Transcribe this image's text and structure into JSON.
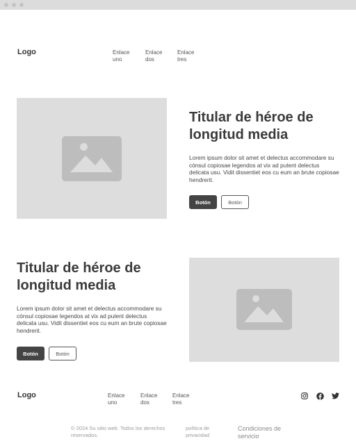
{
  "header": {
    "logo": "Logo",
    "nav": [
      {
        "label": "Enlace uno"
      },
      {
        "label": "Enlace dos"
      },
      {
        "label": "Enlace tres"
      }
    ]
  },
  "hero1": {
    "title": "Titular de héroe de longitud media",
    "body": "Lorem ipsum dolor sit amet et delectus accommodare su cónsul copiosae legendos at vix ad putent delectus delicata usu. Vidit dissentiet eos cu eum an brute copiosae hendrerit.",
    "primary_button": "Botón",
    "secondary_button": "Botón",
    "image_icon": "image-placeholder-icon"
  },
  "hero2": {
    "title": "Titular de héroe de longitud media",
    "body": "Lorem ipsum dolor sit amet et delectus accommodare su cónsul copiosae legendos at vix ad putent delectus delicata usu. Vidit dissentiet eos cu eum an brute copiosae hendrerit.",
    "primary_button": "Botón",
    "secondary_button": "Botón",
    "image_icon": "image-placeholder-icon"
  },
  "footer": {
    "logo": "Logo",
    "nav": [
      {
        "label": "Enlace uno"
      },
      {
        "label": "Enlace dos"
      },
      {
        "label": "Enlace tres"
      }
    ],
    "social": [
      {
        "icon": "instagram-icon"
      },
      {
        "icon": "facebook-icon"
      },
      {
        "icon": "twitter-icon"
      }
    ],
    "copyright": "© 2024 Su sitio web. Todos los derechos reservados.",
    "privacy": "política de privacidad",
    "terms": "Condiciones de servicio"
  },
  "colors": {
    "primary": "#444444",
    "placeholder_bg": "#dddddd",
    "placeholder_icon": "#bdbdbd"
  }
}
